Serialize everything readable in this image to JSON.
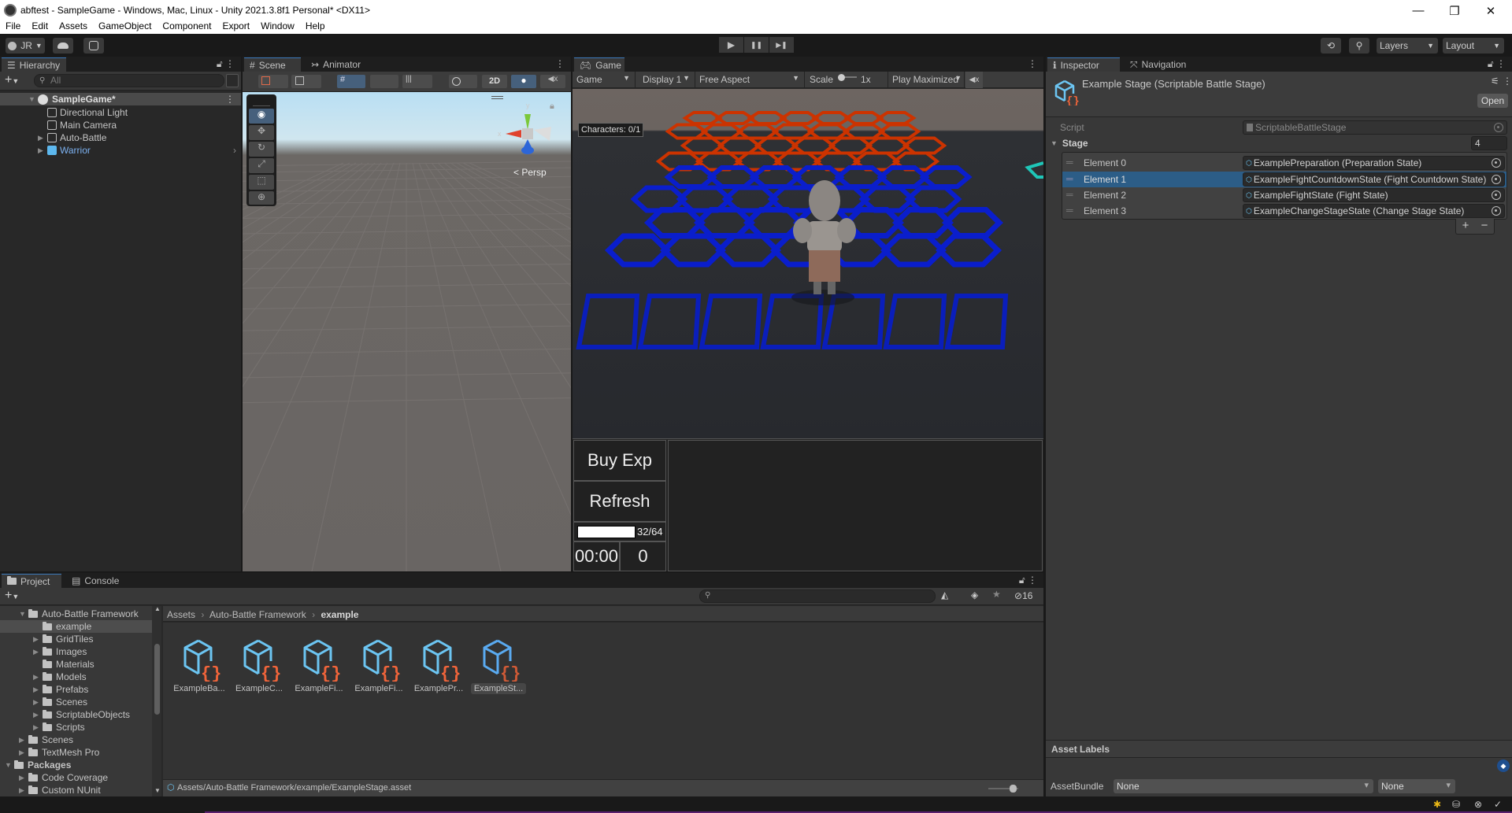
{
  "window": {
    "title": "abftest - SampleGame - Windows, Mac, Linux - Unity 2021.3.8f1 Personal* <DX11>",
    "controls": {
      "minimize": "—",
      "maximize": "❐",
      "close": "✕"
    }
  },
  "menu": [
    "File",
    "Edit",
    "Assets",
    "GameObject",
    "Component",
    "Export",
    "Window",
    "Help"
  ],
  "toolbar": {
    "account": "JR",
    "layers": "Layers",
    "layout": "Layout",
    "play": "▶",
    "pause": "❚❚",
    "step": "▶❚"
  },
  "hierarchy": {
    "tab": "Hierarchy",
    "search_placeholder": "All",
    "scene": "SampleGame*",
    "items": [
      {
        "label": "Directional Light",
        "expandable": false
      },
      {
        "label": "Main Camera",
        "expandable": false
      },
      {
        "label": "Auto-Battle",
        "expandable": true
      },
      {
        "label": "Warrior",
        "expandable": true,
        "prefab": true
      }
    ]
  },
  "scene_view": {
    "tabs": [
      "Scene",
      "Animator"
    ],
    "toolbar_2d": "2D",
    "tools": [
      "view-tool",
      "move-tool",
      "rotate-tool",
      "scale-tool",
      "rect-tool",
      "transform-tool"
    ],
    "gizmo": {
      "x": "x",
      "y": "y",
      "z": "z",
      "projection": "Persp"
    }
  },
  "game_view": {
    "tab": "Game",
    "mode": "Game",
    "display": "Display 1",
    "aspect": "Free Aspect",
    "scale_label": "Scale",
    "scale_value": "1x",
    "play_mode": "Play Maximized",
    "overlay": {
      "characters": "Characters: 0/1",
      "buy_exp": "Buy Exp",
      "refresh": "Refresh",
      "exp_text": "32/64",
      "exp_fraction": 0.5,
      "timer": "00:00",
      "gold": "0"
    },
    "colors": {
      "enemy_tiles": "#cc3300",
      "player_tiles": "#0a1ecc",
      "bench_tiles": "#0a1ebb"
    }
  },
  "inspector": {
    "tabs": [
      "Inspector",
      "Navigation"
    ],
    "object_title": "Example Stage (Scriptable Battle Stage)",
    "open_button": "Open",
    "script_label": "Script",
    "script_value": "ScriptableBattleStage",
    "stage_label": "Stage",
    "stage_size": "4",
    "elements": [
      {
        "label": "Element 0",
        "value": "ExamplePreparation (Preparation State)"
      },
      {
        "label": "Element 1",
        "value": "ExampleFightCountdownState (Fight Countdown State)",
        "selected": true
      },
      {
        "label": "Element 2",
        "value": "ExampleFightState (Fight State)"
      },
      {
        "label": "Element 3",
        "value": "ExampleChangeStageState (Change Stage State)"
      }
    ],
    "add": "+",
    "remove": "−",
    "asset_labels": "Asset Labels",
    "asset_bundle_label": "AssetBundle",
    "asset_bundle_value": "None",
    "asset_bundle_variant": "None"
  },
  "project": {
    "tabs": [
      "Project",
      "Console"
    ],
    "tree": [
      {
        "label": "Auto-Battle Framework",
        "depth": 1,
        "state": "open"
      },
      {
        "label": "example",
        "depth": 2,
        "state": "none",
        "selected": true
      },
      {
        "label": "GridTiles",
        "depth": 2,
        "state": "closed"
      },
      {
        "label": "Images",
        "depth": 2,
        "state": "closed"
      },
      {
        "label": "Materials",
        "depth": 2,
        "state": "none"
      },
      {
        "label": "Models",
        "depth": 2,
        "state": "closed"
      },
      {
        "label": "Prefabs",
        "depth": 2,
        "state": "closed"
      },
      {
        "label": "Scenes",
        "depth": 2,
        "state": "closed"
      },
      {
        "label": "ScriptableObjects",
        "depth": 2,
        "state": "closed"
      },
      {
        "label": "Scripts",
        "depth": 2,
        "state": "closed"
      },
      {
        "label": "Scenes",
        "depth": 1,
        "state": "closed"
      },
      {
        "label": "TextMesh Pro",
        "depth": 1,
        "state": "closed"
      },
      {
        "label": "Packages",
        "depth": 0,
        "state": "open",
        "bold": true
      },
      {
        "label": "Code Coverage",
        "depth": 1,
        "state": "closed"
      },
      {
        "label": "Custom NUnit",
        "depth": 1,
        "state": "closed"
      }
    ],
    "breadcrumb": [
      "Assets",
      "Auto-Battle Framework",
      "example"
    ],
    "hidden_count": "16",
    "assets": [
      {
        "label": "ExampleBa..."
      },
      {
        "label": "ExampleC..."
      },
      {
        "label": "ExampleFi..."
      },
      {
        "label": "ExampleFi..."
      },
      {
        "label": "ExamplePr..."
      },
      {
        "label": "ExampleSt...",
        "selected": true
      }
    ],
    "path": "Assets/Auto-Battle Framework/example/ExampleStage.asset"
  }
}
